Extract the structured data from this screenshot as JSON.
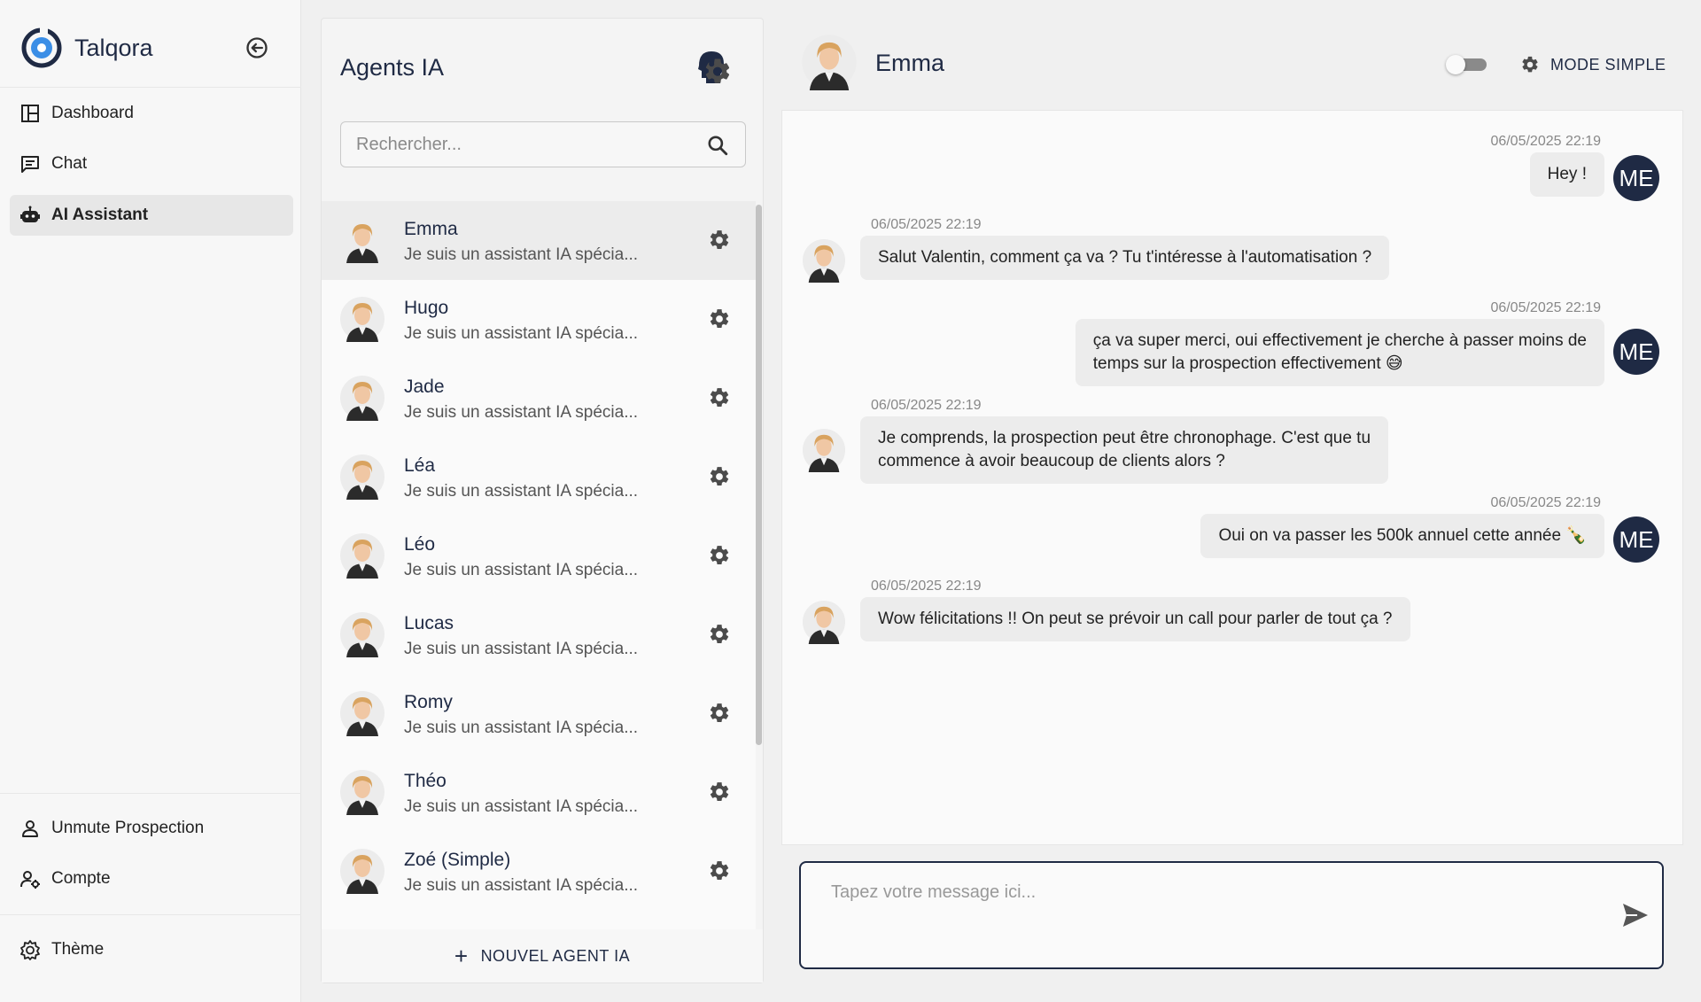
{
  "app": {
    "name": "Talqora"
  },
  "sidebar": {
    "items": [
      {
        "label": "Dashboard",
        "icon": "dashboard-icon"
      },
      {
        "label": "Chat",
        "icon": "chat-icon"
      },
      {
        "label": "AI Assistant",
        "icon": "robot-icon",
        "active": true
      }
    ],
    "bottom_items": [
      {
        "label": "Unmute Prospection",
        "icon": "user-icon"
      },
      {
        "label": "Compte",
        "icon": "user-cog-icon"
      },
      {
        "label": "Thème",
        "icon": "theme-icon"
      }
    ]
  },
  "agents": {
    "title": "Agents IA",
    "search_placeholder": "Rechercher...",
    "new_agent_label": "NOUVEL AGENT IA",
    "list": [
      {
        "name": "Emma",
        "description": "Je suis un assistant IA spécia...",
        "selected": true
      },
      {
        "name": "Hugo",
        "description": "Je suis un assistant IA spécia..."
      },
      {
        "name": "Jade",
        "description": "Je suis un assistant IA spécia..."
      },
      {
        "name": "Léa",
        "description": "Je suis un assistant IA spécia..."
      },
      {
        "name": "Léo",
        "description": "Je suis un assistant IA spécia..."
      },
      {
        "name": "Lucas",
        "description": "Je suis un assistant IA spécia..."
      },
      {
        "name": "Romy",
        "description": "Je suis un assistant IA spécia..."
      },
      {
        "name": "Théo",
        "description": "Je suis un assistant IA spécia..."
      },
      {
        "name": "Zoé (Simple)",
        "description": "Je suis un assistant IA spécia..."
      }
    ]
  },
  "chat": {
    "agent_name": "Emma",
    "mode_label": "MODE SIMPLE",
    "user_initials": "ME",
    "input_placeholder": "Tapez votre message ici...",
    "messages": [
      {
        "from": "user",
        "time": "06/05/2025 22:19",
        "text": "Hey !"
      },
      {
        "from": "agent",
        "time": "06/05/2025 22:19",
        "text": "Salut Valentin, comment ça va ? Tu t'intéresse à l'automatisation ?"
      },
      {
        "from": "user",
        "time": "06/05/2025 22:19",
        "lines": [
          "ça va super merci, oui effectivement je cherche à passer moins de",
          "temps sur la prospection effectivement 😅"
        ]
      },
      {
        "from": "agent",
        "time": "06/05/2025 22:19",
        "lines": [
          "Je comprends, la prospection peut être chronophage. C'est que tu",
          "commence à avoir beaucoup de clients alors ?"
        ]
      },
      {
        "from": "user",
        "time": "06/05/2025 22:19",
        "text": "Oui on va passer les 500k annuel cette année 🍾"
      },
      {
        "from": "agent",
        "time": "06/05/2025 22:19",
        "text": "Wow félicitations !! On peut se prévoir un call pour parler de tout ça ?"
      }
    ]
  },
  "colors": {
    "primary": "#1f2a44",
    "brand_blue": "#2f7fd8",
    "bubble": "#ececec"
  }
}
